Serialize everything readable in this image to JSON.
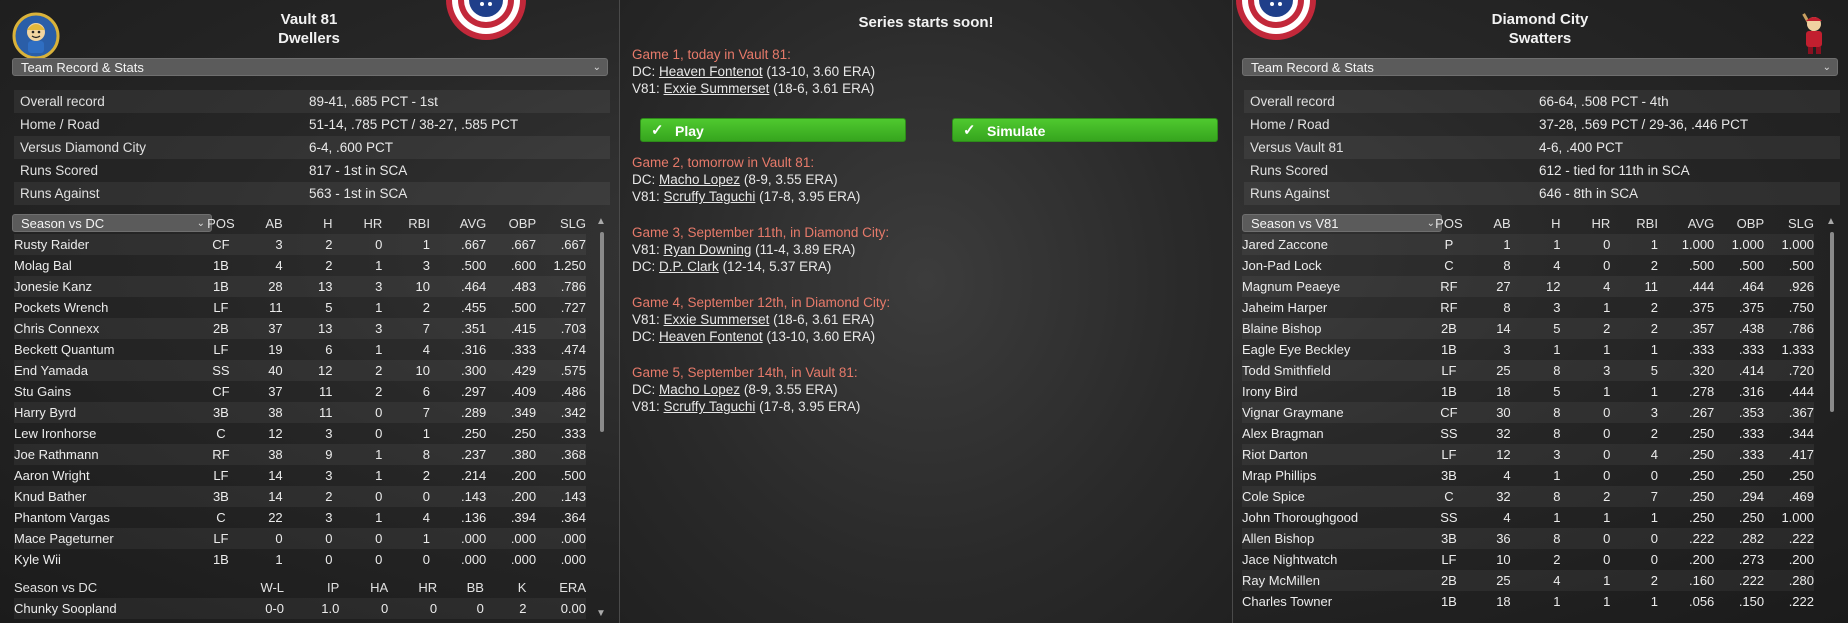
{
  "left": {
    "team_line1": "Vault 81",
    "team_line2": "Dwellers",
    "stats_dropdown": "Team Record & Stats",
    "stats": [
      {
        "label": "Overall record",
        "value": "89-41, .685 PCT - 1st"
      },
      {
        "label": "Home / Road",
        "value": "51-14, .785 PCT / 38-27, .585 PCT"
      },
      {
        "label": "Versus Diamond City",
        "value": "6-4, .600 PCT"
      },
      {
        "label": "Runs Scored",
        "value": "817 - 1st in SCA"
      },
      {
        "label": "Runs Against",
        "value": "563 - 1st in SCA"
      }
    ],
    "batting_dropdown": "Season vs DC",
    "batting_headers": [
      "POS",
      "AB",
      "H",
      "HR",
      "RBI",
      "AVG",
      "OBP",
      "SLG"
    ],
    "batters": [
      {
        "name": "Rusty Raider",
        "pos": "CF",
        "ab": "3",
        "h": "2",
        "hr": "0",
        "rbi": "1",
        "avg": ".667",
        "obp": ".667",
        "slg": ".667"
      },
      {
        "name": "Molag Bal",
        "pos": "1B",
        "ab": "4",
        "h": "2",
        "hr": "1",
        "rbi": "3",
        "avg": ".500",
        "obp": ".600",
        "slg": "1.250"
      },
      {
        "name": "Jonesie Kanz",
        "pos": "1B",
        "ab": "28",
        "h": "13",
        "hr": "3",
        "rbi": "10",
        "avg": ".464",
        "obp": ".483",
        "slg": ".786"
      },
      {
        "name": "Pockets Wrench",
        "pos": "LF",
        "ab": "11",
        "h": "5",
        "hr": "1",
        "rbi": "2",
        "avg": ".455",
        "obp": ".500",
        "slg": ".727"
      },
      {
        "name": "Chris Connexx",
        "pos": "2B",
        "ab": "37",
        "h": "13",
        "hr": "3",
        "rbi": "7",
        "avg": ".351",
        "obp": ".415",
        "slg": ".703"
      },
      {
        "name": "Beckett Quantum",
        "pos": "LF",
        "ab": "19",
        "h": "6",
        "hr": "1",
        "rbi": "4",
        "avg": ".316",
        "obp": ".333",
        "slg": ".474"
      },
      {
        "name": "End Yamada",
        "pos": "SS",
        "ab": "40",
        "h": "12",
        "hr": "2",
        "rbi": "10",
        "avg": ".300",
        "obp": ".429",
        "slg": ".575"
      },
      {
        "name": "Stu Gains",
        "pos": "CF",
        "ab": "37",
        "h": "11",
        "hr": "2",
        "rbi": "6",
        "avg": ".297",
        "obp": ".409",
        "slg": ".486"
      },
      {
        "name": "Harry Byrd",
        "pos": "3B",
        "ab": "38",
        "h": "11",
        "hr": "0",
        "rbi": "7",
        "avg": ".289",
        "obp": ".349",
        "slg": ".342"
      },
      {
        "name": "Lew Ironhorse",
        "pos": "C",
        "ab": "12",
        "h": "3",
        "hr": "0",
        "rbi": "1",
        "avg": ".250",
        "obp": ".250",
        "slg": ".333"
      },
      {
        "name": "Joe Rathmann",
        "pos": "RF",
        "ab": "38",
        "h": "9",
        "hr": "1",
        "rbi": "8",
        "avg": ".237",
        "obp": ".380",
        "slg": ".368"
      },
      {
        "name": "Aaron Wright",
        "pos": "LF",
        "ab": "14",
        "h": "3",
        "hr": "1",
        "rbi": "2",
        "avg": ".214",
        "obp": ".200",
        "slg": ".500"
      },
      {
        "name": "Knud Bather",
        "pos": "3B",
        "ab": "14",
        "h": "2",
        "hr": "0",
        "rbi": "0",
        "avg": ".143",
        "obp": ".200",
        "slg": ".143"
      },
      {
        "name": "Phantom Vargas",
        "pos": "C",
        "ab": "22",
        "h": "3",
        "hr": "1",
        "rbi": "4",
        "avg": ".136",
        "obp": ".394",
        "slg": ".364"
      },
      {
        "name": "Mace Pageturner",
        "pos": "LF",
        "ab": "0",
        "h": "0",
        "hr": "0",
        "rbi": "1",
        "avg": ".000",
        "obp": ".000",
        "slg": ".000"
      },
      {
        "name": "Kyle Wii",
        "pos": "1B",
        "ab": "1",
        "h": "0",
        "hr": "0",
        "rbi": "0",
        "avg": ".000",
        "obp": ".000",
        "slg": ".000"
      }
    ],
    "pitching_label": "Season vs DC",
    "pitching_headers": [
      "W-L",
      "IP",
      "HA",
      "HR",
      "BB",
      "K",
      "ERA"
    ],
    "pitchers": [
      {
        "name": "Chunky Soopland",
        "wl": "0-0",
        "ip": "1.0",
        "ha": "0",
        "hr": "0",
        "bb": "0",
        "k": "2",
        "era": "0.00"
      }
    ]
  },
  "center": {
    "title": "Series starts soon!",
    "play_label": "Play",
    "simulate_label": "Simulate",
    "games": [
      {
        "head": "Game 1, today in Vault 81:",
        "lines": [
          {
            "team": "DC:",
            "pitcher": "Heaven Fontenot",
            "stats": "(13-10, 3.60 ERA)"
          },
          {
            "team": "V81:",
            "pitcher": "Exxie Summerset",
            "stats": "(18-6, 3.61 ERA)"
          }
        ]
      },
      {
        "head": "Game 2, tomorrow in Vault 81:",
        "lines": [
          {
            "team": "DC:",
            "pitcher": "Macho Lopez",
            "stats": "(8-9, 3.55 ERA)"
          },
          {
            "team": "V81:",
            "pitcher": "Scruffy Taguchi",
            "stats": "(17-8, 3.95 ERA)"
          }
        ]
      },
      {
        "head": "Game 3, September 11th,  in Diamond City:",
        "lines": [
          {
            "team": "V81:",
            "pitcher": "Ryan Downing",
            "stats": "(11-4, 3.89 ERA)"
          },
          {
            "team": "DC:",
            "pitcher": "D.P. Clark",
            "stats": "(12-14, 5.37 ERA)"
          }
        ]
      },
      {
        "head": "Game 4, September 12th,  in Diamond City:",
        "lines": [
          {
            "team": "V81:",
            "pitcher": "Exxie Summerset",
            "stats": "(18-6, 3.61 ERA)"
          },
          {
            "team": "DC:",
            "pitcher": "Heaven Fontenot",
            "stats": "(13-10, 3.60 ERA)"
          }
        ]
      },
      {
        "head": "Game 5, September 14th,  in Vault 81:",
        "lines": [
          {
            "team": "DC:",
            "pitcher": "Macho Lopez",
            "stats": "(8-9, 3.55 ERA)"
          },
          {
            "team": "V81:",
            "pitcher": "Scruffy Taguchi",
            "stats": "(17-8, 3.95 ERA)"
          }
        ]
      }
    ]
  },
  "right": {
    "team_line1": "Diamond City",
    "team_line2": "Swatters",
    "stats_dropdown": "Team Record & Stats",
    "stats": [
      {
        "label": "Overall record",
        "value": "66-64, .508 PCT - 4th"
      },
      {
        "label": "Home / Road",
        "value": "37-28, .569 PCT / 29-36, .446 PCT"
      },
      {
        "label": "Versus Vault 81",
        "value": "4-6, .400 PCT"
      },
      {
        "label": "Runs Scored",
        "value": "612 - tied for 11th in SCA"
      },
      {
        "label": "Runs Against",
        "value": "646 - 8th in SCA"
      }
    ],
    "batting_dropdown": "Season vs V81",
    "batting_headers": [
      "POS",
      "AB",
      "H",
      "HR",
      "RBI",
      "AVG",
      "OBP",
      "SLG"
    ],
    "batters": [
      {
        "name": "Jared Zaccone",
        "pos": "P",
        "ab": "1",
        "h": "1",
        "hr": "0",
        "rbi": "1",
        "avg": "1.000",
        "obp": "1.000",
        "slg": "1.000"
      },
      {
        "name": "Jon-Pad Lock",
        "pos": "C",
        "ab": "8",
        "h": "4",
        "hr": "0",
        "rbi": "2",
        "avg": ".500",
        "obp": ".500",
        "slg": ".500"
      },
      {
        "name": "Magnum Peaeye",
        "pos": "RF",
        "ab": "27",
        "h": "12",
        "hr": "4",
        "rbi": "11",
        "avg": ".444",
        "obp": ".464",
        "slg": ".926"
      },
      {
        "name": "Jaheim Harper",
        "pos": "RF",
        "ab": "8",
        "h": "3",
        "hr": "1",
        "rbi": "2",
        "avg": ".375",
        "obp": ".375",
        "slg": ".750"
      },
      {
        "name": "Blaine Bishop",
        "pos": "2B",
        "ab": "14",
        "h": "5",
        "hr": "2",
        "rbi": "2",
        "avg": ".357",
        "obp": ".438",
        "slg": ".786"
      },
      {
        "name": "Eagle Eye Beckley",
        "pos": "1B",
        "ab": "3",
        "h": "1",
        "hr": "1",
        "rbi": "1",
        "avg": ".333",
        "obp": ".333",
        "slg": "1.333"
      },
      {
        "name": "Todd Smithfield",
        "pos": "LF",
        "ab": "25",
        "h": "8",
        "hr": "3",
        "rbi": "5",
        "avg": ".320",
        "obp": ".414",
        "slg": ".720"
      },
      {
        "name": "Irony Bird",
        "pos": "1B",
        "ab": "18",
        "h": "5",
        "hr": "1",
        "rbi": "1",
        "avg": ".278",
        "obp": ".316",
        "slg": ".444"
      },
      {
        "name": "Vignar Graymane",
        "pos": "CF",
        "ab": "30",
        "h": "8",
        "hr": "0",
        "rbi": "3",
        "avg": ".267",
        "obp": ".353",
        "slg": ".367"
      },
      {
        "name": "Alex Bragman",
        "pos": "SS",
        "ab": "32",
        "h": "8",
        "hr": "0",
        "rbi": "2",
        "avg": ".250",
        "obp": ".333",
        "slg": ".344"
      },
      {
        "name": "Riot Darton",
        "pos": "LF",
        "ab": "12",
        "h": "3",
        "hr": "0",
        "rbi": "4",
        "avg": ".250",
        "obp": ".333",
        "slg": ".417"
      },
      {
        "name": "Mrap Phillips",
        "pos": "3B",
        "ab": "4",
        "h": "1",
        "hr": "0",
        "rbi": "0",
        "avg": ".250",
        "obp": ".250",
        "slg": ".250"
      },
      {
        "name": "Cole Spice",
        "pos": "C",
        "ab": "32",
        "h": "8",
        "hr": "2",
        "rbi": "7",
        "avg": ".250",
        "obp": ".294",
        "slg": ".469"
      },
      {
        "name": "John Thoroughgood",
        "pos": "SS",
        "ab": "4",
        "h": "1",
        "hr": "1",
        "rbi": "1",
        "avg": ".250",
        "obp": ".250",
        "slg": "1.000"
      },
      {
        "name": "Allen Bishop",
        "pos": "3B",
        "ab": "36",
        "h": "8",
        "hr": "0",
        "rbi": "0",
        "avg": ".222",
        "obp": ".282",
        "slg": ".222"
      },
      {
        "name": "Jace Nightwatch",
        "pos": "LF",
        "ab": "10",
        "h": "2",
        "hr": "0",
        "rbi": "0",
        "avg": ".200",
        "obp": ".273",
        "slg": ".200"
      },
      {
        "name": "Ray McMillen",
        "pos": "2B",
        "ab": "25",
        "h": "4",
        "hr": "1",
        "rbi": "2",
        "avg": ".160",
        "obp": ".222",
        "slg": ".280"
      },
      {
        "name": "Charles Towner",
        "pos": "1B",
        "ab": "18",
        "h": "1",
        "hr": "1",
        "rbi": "1",
        "avg": ".056",
        "obp": ".150",
        "slg": ".222"
      }
    ]
  }
}
